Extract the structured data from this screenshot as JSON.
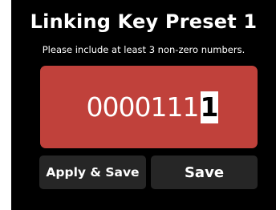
{
  "header": {
    "title": "Linking Key Preset 1",
    "subtitle": "Please include at least 3 non-zero numbers."
  },
  "key": {
    "digits": [
      "0",
      "0",
      "0",
      "0",
      "1",
      "1",
      "1",
      "1"
    ],
    "selected_index": 7,
    "box_color": "#c0413b"
  },
  "buttons": {
    "apply_save_label": "Apply & Save",
    "save_label": "Save"
  }
}
